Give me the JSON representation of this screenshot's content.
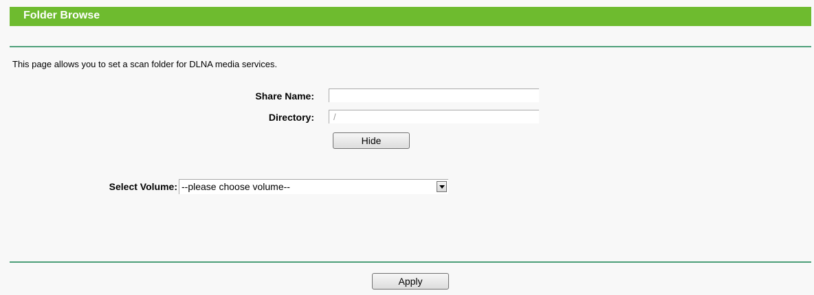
{
  "header": {
    "title": "Folder Browse"
  },
  "description": "This page allows you to set a scan folder for DLNA media services.",
  "form": {
    "share_name": {
      "label": "Share Name:",
      "value": ""
    },
    "directory": {
      "label": "Directory:",
      "value": "",
      "placeholder": "/"
    },
    "hide_button_label": "Hide",
    "select_volume": {
      "label": "Select Volume:",
      "selected": "--please choose volume--",
      "icon": "chevron-down-icon"
    }
  },
  "footer": {
    "apply_button_label": "Apply"
  },
  "colors": {
    "header_background": "#6ebb2f",
    "divider": "#4b9e78",
    "page_background": "#f8f8f8"
  }
}
